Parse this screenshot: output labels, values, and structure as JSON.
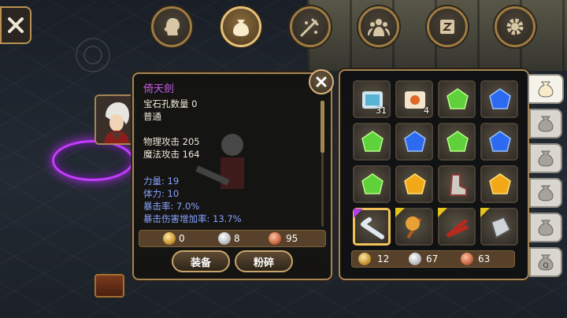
{
  "top_tabs": [
    {
      "name": "character",
      "icon": "head-silhouette-icon",
      "active": false
    },
    {
      "name": "inventory",
      "icon": "bag-icon",
      "active": true
    },
    {
      "name": "skills",
      "icon": "sword-sparkle-icon",
      "active": false
    },
    {
      "name": "party",
      "icon": "party-icon",
      "active": false
    },
    {
      "name": "quests",
      "icon": "scroll-icon",
      "active": false
    },
    {
      "name": "settings",
      "icon": "gear-icon",
      "active": false
    }
  ],
  "item": {
    "name": "倚天劍",
    "gem_slots": "宝石孔数量 0",
    "quality": "普通",
    "phys_attack": "物理攻击 205",
    "magic_attack": "魔法攻击 164",
    "strength": "力量: 19",
    "stamina": "体力: 10",
    "crit_rate": "暴击率: 7.0%",
    "crit_damage": "暴击伤害增加率: 13.7%",
    "price": {
      "gold": "0",
      "silver": "8",
      "copper": "95"
    },
    "equip_label": "装备",
    "smash_label": "粉碎",
    "name_color": "#c65ae8",
    "bonus_color": "#88a3ff"
  },
  "inventory": {
    "slots": [
      {
        "icon": "blue-scroll-icon",
        "qty": "31"
      },
      {
        "icon": "orange-scroll-icon",
        "qty": "4"
      },
      {
        "icon": "green-gem-icon",
        "qty": ""
      },
      {
        "icon": "blue-gem-icon",
        "qty": ""
      },
      {
        "icon": "green-gem-icon",
        "qty": ""
      },
      {
        "icon": "blue-gem-icon",
        "qty": ""
      },
      {
        "icon": "green-gem-icon",
        "qty": ""
      },
      {
        "icon": "blue-gem-icon",
        "qty": ""
      },
      {
        "icon": "green-gem-icon",
        "qty": ""
      },
      {
        "icon": "yellow-gem-icon",
        "qty": ""
      },
      {
        "icon": "boots-icon",
        "qty": ""
      },
      {
        "icon": "yellow-gem-icon",
        "qty": ""
      },
      {
        "icon": "sword-icon",
        "qty": "",
        "selected": true,
        "rarity": "#b13ee0"
      },
      {
        "icon": "axe-icon",
        "qty": "",
        "rarity": "#e6c31d"
      },
      {
        "icon": "claw-icon",
        "qty": "",
        "rarity": "#e6c31d"
      },
      {
        "icon": "gauntlet-icon",
        "qty": "",
        "rarity": "#e6c31d"
      }
    ],
    "money": {
      "gold": "12",
      "silver": "67",
      "copper": "63"
    }
  },
  "side_tabs": [
    {
      "icon": "bag-icon",
      "label": "",
      "active": true
    },
    {
      "icon": "bag-icon",
      "label": "",
      "active": false
    },
    {
      "icon": "bag-icon",
      "label": "",
      "active": false
    },
    {
      "icon": "bag-icon",
      "label": "",
      "active": false
    },
    {
      "icon": "bag-icon",
      "label": "",
      "active": false
    },
    {
      "icon": "quest-bag-icon",
      "label": "Q",
      "active": false
    }
  ]
}
